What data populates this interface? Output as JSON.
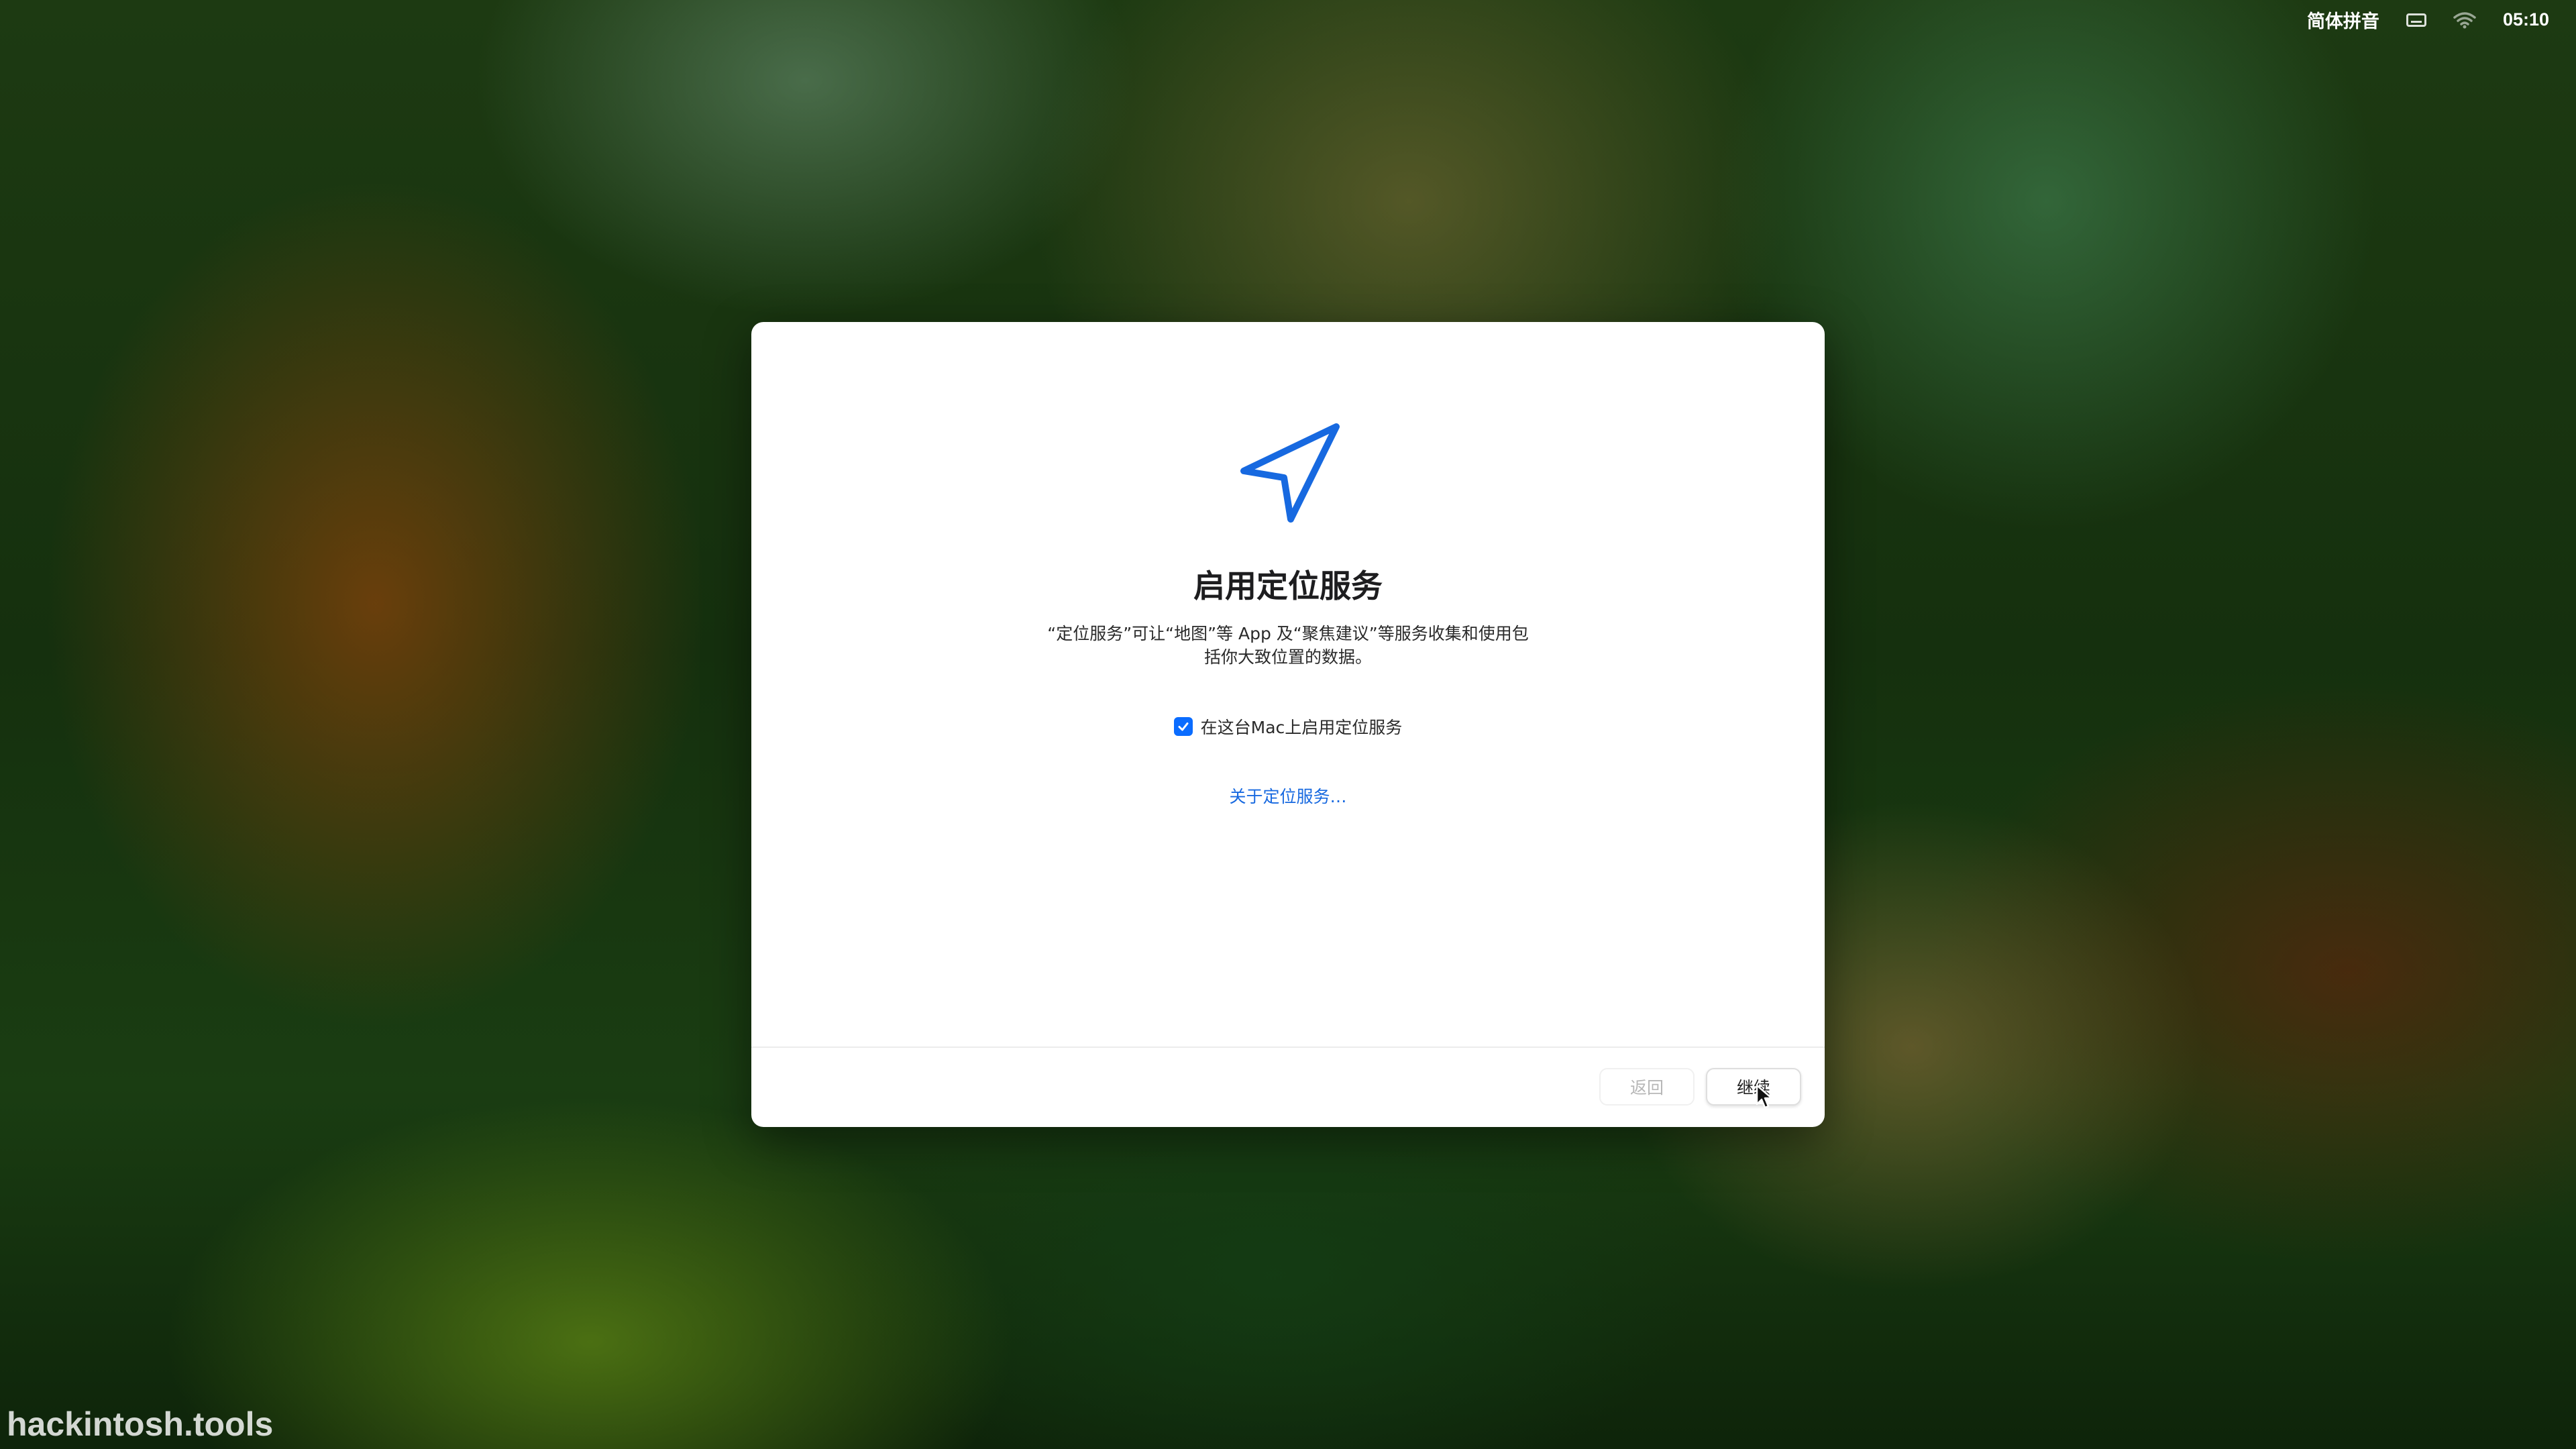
{
  "menubar": {
    "input_method": "简体拼音",
    "keyboard_icon": "keyboard-icon",
    "wifi_icon": "wifi-icon",
    "clock": "05:10"
  },
  "dialog": {
    "icon": "location-arrow-icon",
    "accent_color": "#1769e0",
    "title": "启用定位服务",
    "description_line1": "“定位服务”可让“地图”等 App 及“聚焦建议”等服务收集和使用包",
    "description_line2": "括你大致位置的数据。",
    "checkbox_label": "在这台Mac上启用定位服务",
    "checkbox_checked": true,
    "about_link": "关于定位服务…",
    "back_label": "返回",
    "continue_label": "继续"
  },
  "watermark": "hackintosh.tools"
}
